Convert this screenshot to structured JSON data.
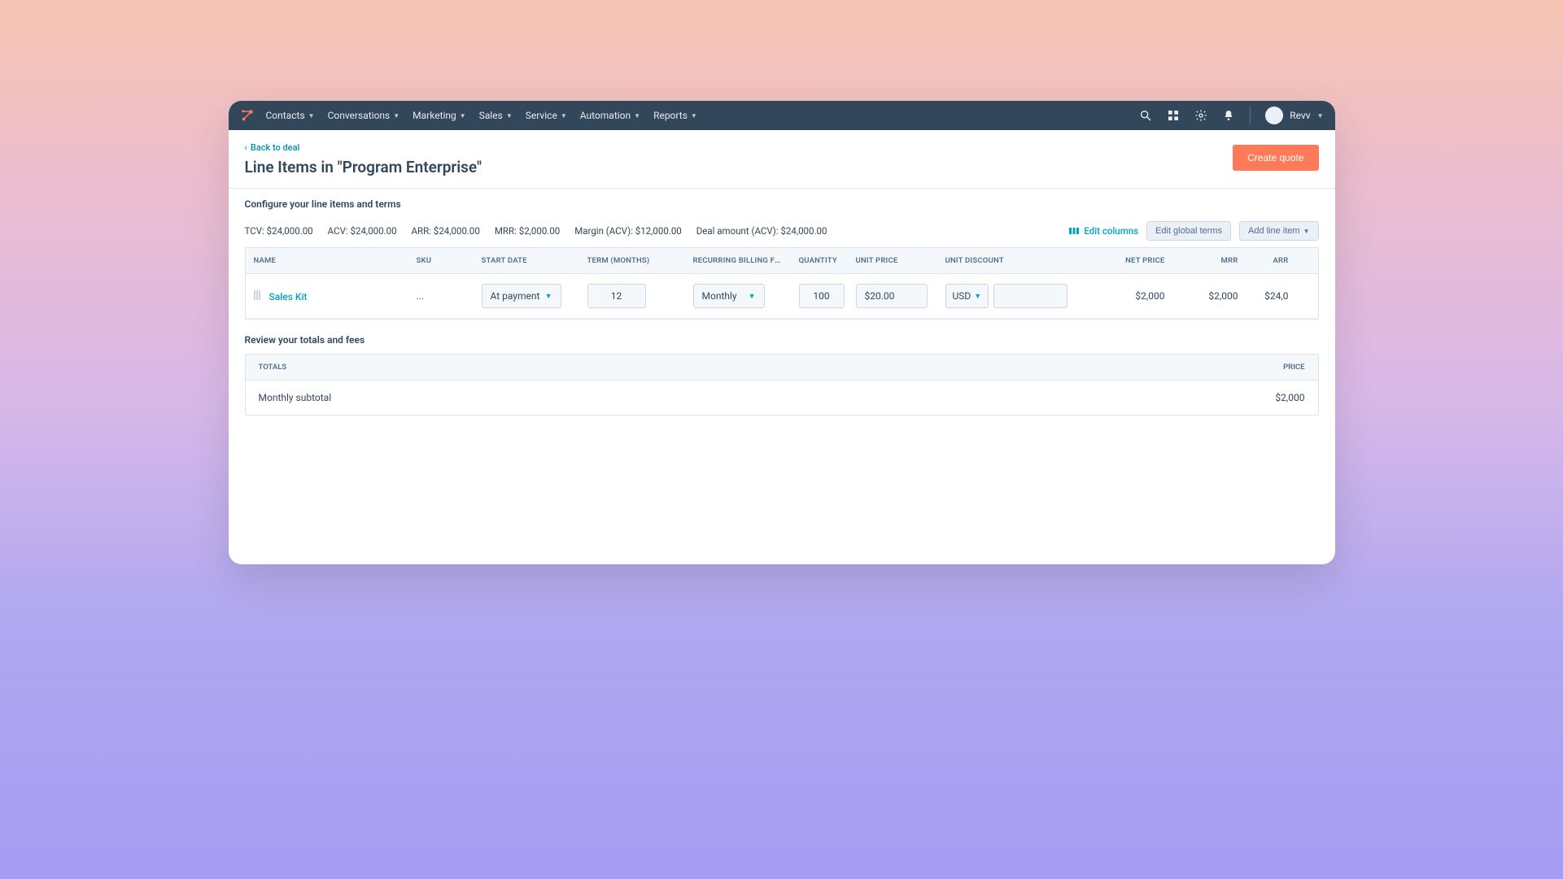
{
  "nav": {
    "items": [
      "Contacts",
      "Conversations",
      "Marketing",
      "Sales",
      "Service",
      "Automation",
      "Reports"
    ],
    "account": "Revv"
  },
  "header": {
    "back": "Back to deal",
    "title": "Line Items in \"Program Enterprise\"",
    "create_quote": "Create quote"
  },
  "config": {
    "subtitle": "Configure your line items and terms",
    "tcv": "TCV: $24,000.00",
    "acv": "ACV: $24,000.00",
    "arr": "ARR: $24,000.00",
    "mrr": "MRR: $2,000.00",
    "margin": "Margin (ACV): $12,000.00",
    "deal_amount": "Deal amount (ACV): $24,000.00",
    "edit_columns": "Edit columns",
    "edit_global": "Edit global terms",
    "add_line_item": "Add line item"
  },
  "columns": {
    "name": "NAME",
    "sku": "SKU",
    "start": "START DATE",
    "term": "TERM (MONTHS)",
    "freq": "RECURRING BILLING FREQ.",
    "qty": "QUANTITY",
    "unit_price": "UNIT PRICE",
    "unit_discount": "UNIT DISCOUNT",
    "net": "NET PRICE",
    "mrr": "MRR",
    "arr": "ARR"
  },
  "row": {
    "name": "Sales Kit",
    "sku": "...",
    "start": "At payment",
    "term": "12",
    "freq": "Monthly",
    "qty": "100",
    "unit_price": "$20.00",
    "discount_currency": "USD",
    "net": "$2,000",
    "mrr": "$2,000",
    "arr": "$24,0"
  },
  "totals": {
    "review": "Review your totals and fees",
    "totals_label": "TOTALS",
    "price_label": "PRICE",
    "subtotal_label": "Monthly subtotal",
    "subtotal_value": "$2,000"
  }
}
